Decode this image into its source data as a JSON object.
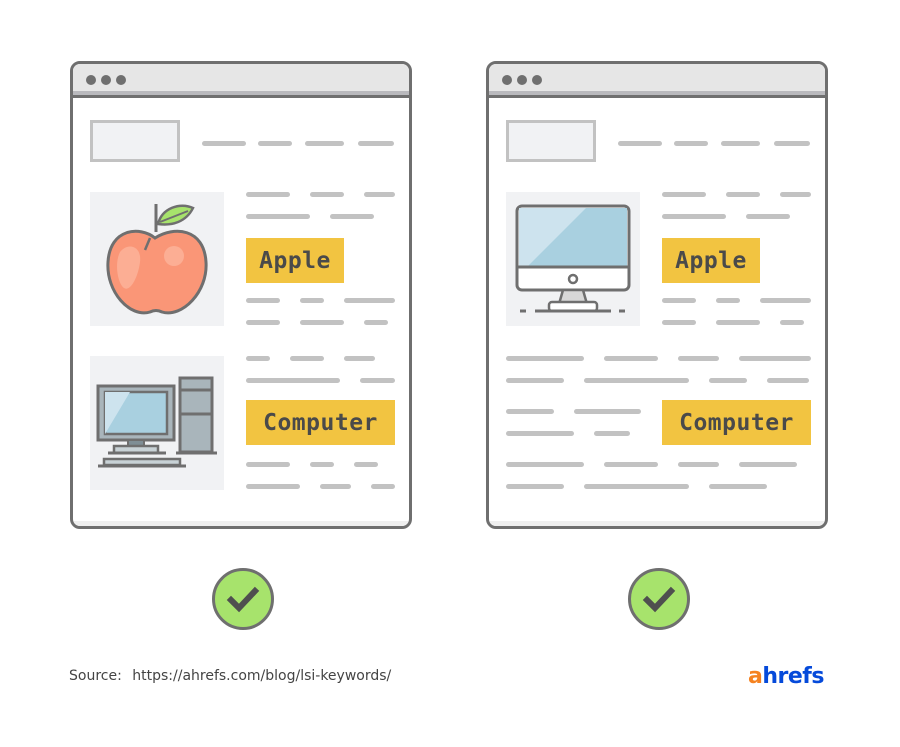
{
  "panels": [
    {
      "id": "left",
      "thumbnails": [
        {
          "icon": "apple-fruit-icon",
          "keyword": "Apple"
        },
        {
          "icon": "desktop-computer-icon",
          "keyword": "Computer"
        }
      ],
      "verdict": "check-icon"
    },
    {
      "id": "right",
      "thumbnails": [
        {
          "icon": "imac-icon",
          "keyword": "Apple"
        }
      ],
      "inline_keywords": [
        "Computer"
      ],
      "verdict": "check-icon"
    }
  ],
  "footer": {
    "source_label": "Source:",
    "source_url": "https://ahrefs.com/blog/lsi-keywords/",
    "brand_first": "a",
    "brand_rest": "hrefs"
  },
  "colors": {
    "tag": "#f2c441",
    "check": "#a7e36c",
    "outline": "#6f6f6f",
    "placeholder_line": "#c2c2c2",
    "brand_orange": "#f58220",
    "brand_blue": "#054ada"
  }
}
